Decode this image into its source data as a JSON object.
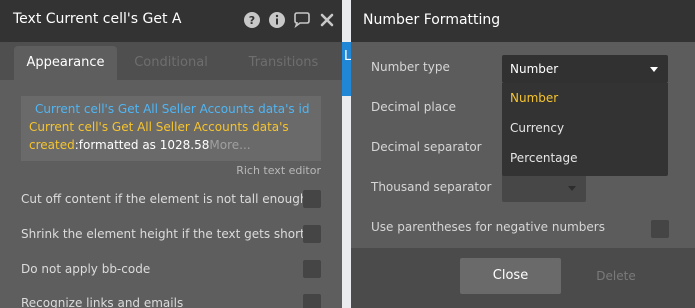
{
  "left_panel": {
    "title": "Text Current cell's Get A",
    "icons": [
      "help-icon",
      "info-icon",
      "comment-icon",
      "close-icon"
    ],
    "tabs": {
      "appearance": "Appearance",
      "conditional": "Conditional",
      "transitions": "Transitions"
    },
    "text_content": {
      "line1": "Current cell's Get All Seller Accounts data's id",
      "line2": "Current cell's Get All Seller Accounts data's",
      "line3_created": "created",
      "line3_format": ":formatted as 1028.58",
      "more": "More..."
    },
    "rich_text_editor": "Rich text editor",
    "options": [
      "Cut off content if the element is not tall enough",
      "Shrink the element height if the text gets shorter",
      "Do not apply bb-code",
      "Recognize links and emails"
    ]
  },
  "background_strip_text": "L",
  "modal": {
    "title": "Number Formatting",
    "labels": {
      "number_type": "Number type",
      "decimal_place": "Decimal place",
      "decimal_separator": "Decimal separator",
      "thousand_separator": "Thousand separator",
      "parentheses": "Use parentheses for negative numbers"
    },
    "number_type_value": "Number",
    "dropdown_options": [
      "Number",
      "Currency",
      "Percentage"
    ],
    "buttons": {
      "close": "Close",
      "delete": "Delete"
    }
  },
  "colors": {
    "dynamic_blue": "#4fb6f5",
    "dynamic_yellow": "#f6c42e",
    "accent_blue": "#1f87d6"
  }
}
